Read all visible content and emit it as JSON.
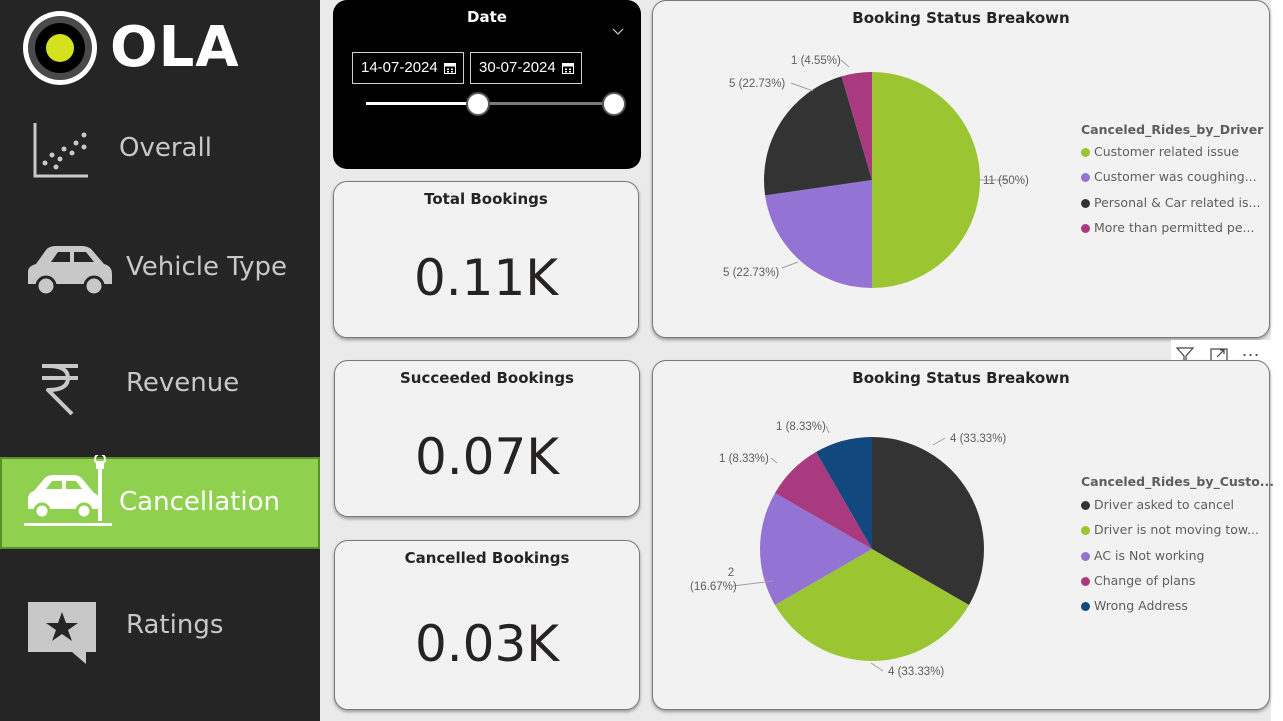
{
  "brand": {
    "name": "OLA"
  },
  "sidebar": {
    "items": [
      {
        "label": "Overall",
        "icon": "scatter-chart-icon",
        "active": false
      },
      {
        "label": "Vehicle Type",
        "icon": "car-icon",
        "active": false
      },
      {
        "label": "Revenue",
        "icon": "rupee-icon",
        "active": false
      },
      {
        "label": "Cancellation",
        "icon": "car-crash-icon",
        "active": true
      },
      {
        "label": "Ratings",
        "icon": "star-comment-icon",
        "active": false
      }
    ],
    "active_color": "#8fd14f"
  },
  "date_slicer": {
    "title": "Date",
    "start": "14-07-2024",
    "end": "30-07-2024"
  },
  "kpis": [
    {
      "title": "Total Bookings",
      "value": "0.11K"
    },
    {
      "title": "Succeeded Bookings",
      "value": "0.07K"
    },
    {
      "title": "Cancelled Bookings",
      "value": "0.03K"
    }
  ],
  "chart_data": [
    {
      "type": "pie",
      "title": "Booking Status Breakown",
      "legend_title": "Canceled_Rides_by_Driver",
      "legend_position": "right",
      "slices": [
        {
          "name": "Customer related issue",
          "legend_label": "Customer related issue",
          "value": 11,
          "label": "11 (50%)",
          "color": "#9bc531"
        },
        {
          "name": "Customer was coughing/sick",
          "legend_label": "Customer was coughing...",
          "value": 5,
          "label": "5 (22.73%)",
          "color": "#9373d3"
        },
        {
          "name": "Personal & Car related issues",
          "legend_label": "Personal & Car related is...",
          "value": 5,
          "label": "5 (22.73%)",
          "color": "#333333"
        },
        {
          "name": "More than permitted people in there",
          "legend_label": "More than permitted pe...",
          "value": 1,
          "label": "1 (4.55%)",
          "color": "#a93a80"
        }
      ]
    },
    {
      "type": "pie",
      "title": "Booking Status Breakown",
      "legend_title": "Canceled_Rides_by_Custo...",
      "legend_position": "right",
      "slices": [
        {
          "name": "Driver asked to cancel",
          "legend_label": "Driver asked to cancel",
          "value": 4,
          "label": "4 (33.33%)",
          "color": "#333333"
        },
        {
          "name": "Driver is not moving towards pickup location",
          "legend_label": "Driver is not moving tow...",
          "value": 4,
          "label": "4 (33.33%)",
          "color": "#9bc531"
        },
        {
          "name": "AC is Not working",
          "legend_label": "AC is Not working",
          "value": 2,
          "label": "2\n(16.67%)",
          "label_line1": "2",
          "label_line2": "(16.67%)",
          "color": "#9373d3"
        },
        {
          "name": "Change of plans",
          "legend_label": "Change of plans",
          "value": 1,
          "label": "1 (8.33%)",
          "color": "#a93a80"
        },
        {
          "name": "Wrong Address",
          "legend_label": "Wrong Address",
          "value": 1,
          "label": "1 (8.33%)",
          "color": "#12487e"
        }
      ]
    }
  ],
  "visual_header": {
    "icons": [
      "filter-icon",
      "focus-mode-icon",
      "more-options-icon"
    ],
    "more_label": "..."
  }
}
